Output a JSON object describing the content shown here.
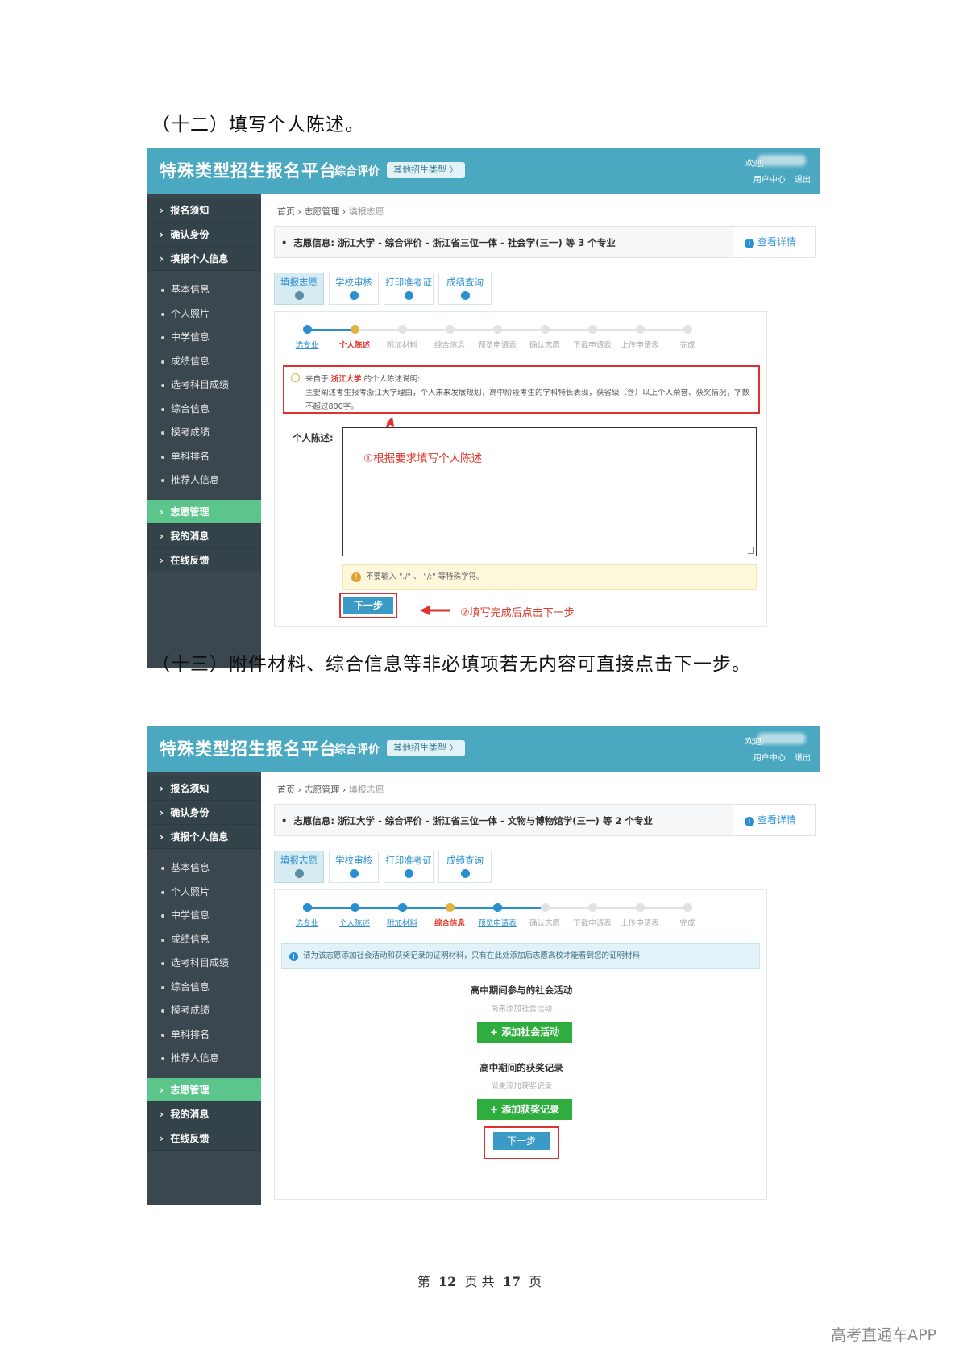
{
  "section1": {
    "heading": "（十二）填写个人陈述。",
    "header": {
      "brand": "特殊类型招生报名平台",
      "subtitle": "综合评价",
      "type_button": "其他招生类型 〉",
      "welcome": "欢迎,",
      "user_center": "用户中心",
      "logout": "退出"
    },
    "sidebar": {
      "top_items": [
        "报名须知",
        "确认身份",
        "填报个人信息"
      ],
      "sub_items": [
        "基本信息",
        "个人照片",
        "中学信息",
        "成绩信息",
        "选考科目成绩",
        "综合信息",
        "模考成绩",
        "单科排名",
        "推荐人信息"
      ],
      "bottom_items": [
        "志愿管理",
        "我的消息",
        "在线反馈"
      ]
    },
    "breadcrumb": {
      "home": "首页",
      "level2": "志愿管理",
      "current": "填报志愿"
    },
    "info": {
      "text": "志愿信息:  浙江大学 - 综合评价 - 浙江省三位一体 - 社会学(三一) 等 3 个专业",
      "link": "查看详情"
    },
    "tabs": [
      "填报志愿",
      "学校审核",
      "打印准考证",
      "成绩查询"
    ],
    "steps": [
      "选专业",
      "个人陈述",
      "附加材料",
      "综合信息",
      "预览申请表",
      "确认志愿",
      "下载申请表",
      "上传申请表",
      "完成"
    ],
    "steps_done": 1,
    "steps_current": 1,
    "notice": {
      "prefix": "来自于",
      "school": "浙江大学",
      "suffix": "的个人陈述说明:",
      "body": "主要阐述考生报考浙江大学理由，个人未来发展规划，高中阶段考生的学科特长表现，获省级（含）以上个人荣誉、获奖情况，字数不超过800字。"
    },
    "statement_label": "个人陈述:",
    "annotation1": "①根据要求填写个人陈述",
    "warning": "不要输入 \"./\" 、 \"/:\" 等特殊字符。",
    "next_label": "下一步",
    "annotation2": "②填写完成后点击下一步"
  },
  "section2": {
    "heading": "（十三）附件材料、综合信息等非必填项若无内容可直接点击下一步。",
    "header": {
      "brand": "特殊类型招生报名平台",
      "subtitle": "综合评价",
      "type_button": "其他招生类型 〉",
      "welcome": "欢迎,",
      "user_center": "用户中心",
      "logout": "退出"
    },
    "sidebar": {
      "top_items": [
        "报名须知",
        "确认身份",
        "填报个人信息"
      ],
      "sub_items": [
        "基本信息",
        "个人照片",
        "中学信息",
        "成绩信息",
        "选考科目成绩",
        "综合信息",
        "模考成绩",
        "单科排名",
        "推荐人信息"
      ],
      "bottom_items": [
        "志愿管理",
        "我的消息",
        "在线反馈"
      ]
    },
    "breadcrumb": {
      "home": "首页",
      "level2": "志愿管理",
      "current": "填报志愿"
    },
    "info": {
      "text": "志愿信息:  浙江大学 - 综合评价 - 浙江省三位一体 - 文物与博物馆学(三一) 等 2 个专业",
      "link": "查看详情"
    },
    "tabs": [
      "填报志愿",
      "学校审核",
      "打印准考证",
      "成绩查询"
    ],
    "steps": [
      "选专业",
      "个人陈述",
      "附加材料",
      "综合信息",
      "预览申请表",
      "确认志愿",
      "下载申请表",
      "上传申请表",
      "完成"
    ],
    "steps_done": 5,
    "steps_current": 3,
    "alert": "请为该志愿添加社会活动和获奖记录的证明材料，只有在此处添加后志愿高校才能看到您的证明材料",
    "social": {
      "title": "高中期间参与的社会活动",
      "empty": "尚未添加社会活动",
      "button": "+ 添加社会活动"
    },
    "awards": {
      "title": "高中期间的获奖记录",
      "empty": "尚未添加获奖记录",
      "button": "+ 添加获奖记录"
    },
    "next_label": "下一步"
  },
  "footer": {
    "prefix": "第",
    "page": "12",
    "mid": "页 共",
    "total": "17",
    "suffix": "页"
  },
  "watermark": "高考直通车APP",
  "colors": {
    "header": "#4aa8c0",
    "sidebar": "#3a474f",
    "active_nav": "#5cc58c",
    "link": "#2a8fd0",
    "highlight_red": "#e03030",
    "green_button": "#2fae3f"
  }
}
